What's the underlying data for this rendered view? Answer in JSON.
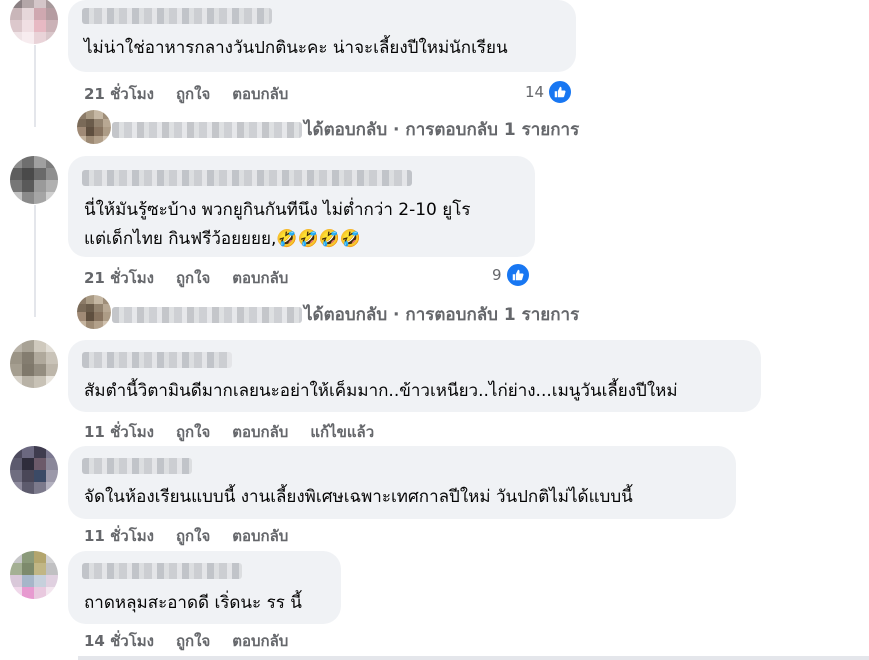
{
  "comments": [
    {
      "text_lines": [
        "ไม่น่าใช่อาหารกลางวันปกตินะคะ น่าจะเลี้ยงปีใหม่นักเรียน"
      ],
      "time": "21 ชั่วโมง",
      "like": "ถูกใจ",
      "reply": "ตอบกลับ",
      "reactions": "14",
      "view_replies": "ได้ตอบกลับ · การตอบกลับ 1 รายการ"
    },
    {
      "text_lines": [
        "นี่ให้มันรู้ซะบ้าง พวกยูกินกันทีนึง ไม่ต่ำกว่า 2-10 ยูโร",
        "แต่เด็กไทย กินฟรีว้อยยยย,🤣🤣🤣🤣"
      ],
      "time": "21 ชั่วโมง",
      "like": "ถูกใจ",
      "reply": "ตอบกลับ",
      "reactions": "9",
      "view_replies": "ได้ตอบกลับ · การตอบกลับ 1 รายการ"
    },
    {
      "text_lines": [
        "สัมตำนี้วิตามินดีมากเลยนะอย่าให้เค็มมาก..ข้าวเหนียว..ไก่ย่าง...เมนูวันเลี้ยงปีใหม่"
      ],
      "time": "11 ชั่วโมง",
      "like": "ถูกใจ",
      "reply": "ตอบกลับ",
      "edited": "แก้ไขแล้ว"
    },
    {
      "text_lines": [
        "จัดในห้องเรียนแบบนี้ งานเลี้ยงพิเศษเฉพาะเทศกาลปีใหม่ วันปกติไม่ได้แบบนี้"
      ],
      "time": "11 ชั่วโมง",
      "like": "ถูกใจ",
      "reply": "ตอบกลับ"
    },
    {
      "text_lines": [
        "ถาดหลุมสะอาดดี เริ่ดนะ รร นี้"
      ],
      "time": "14 ชั่วโมง",
      "like": "ถูกใจ",
      "reply": "ตอบกลับ"
    }
  ],
  "colors": {
    "like_blue": "#1877f2",
    "bubble": "#f0f2f5",
    "meta": "#65676b"
  }
}
